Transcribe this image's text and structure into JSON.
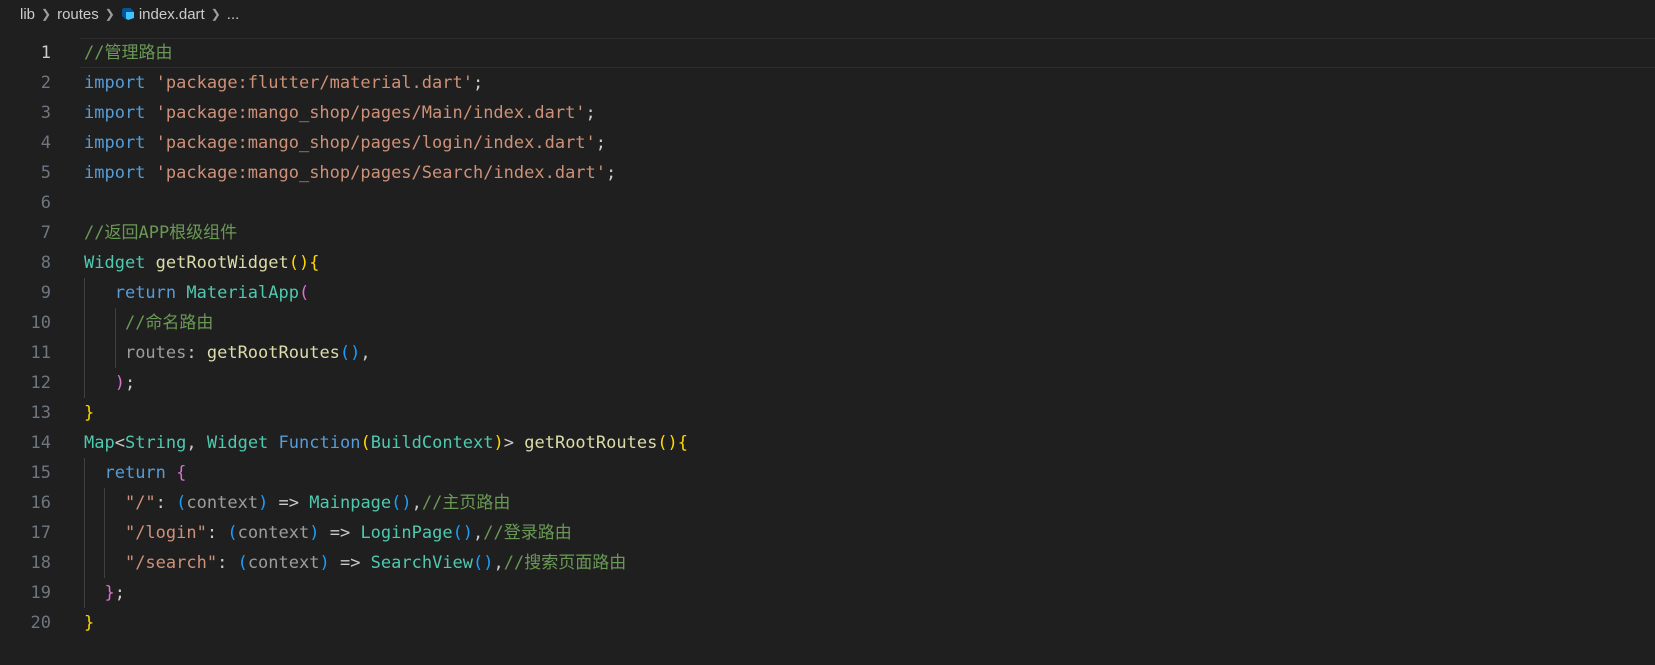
{
  "breadcrumb": {
    "items": [
      "lib",
      "routes",
      "index.dart",
      "..."
    ]
  },
  "editor": {
    "language": "dart",
    "active_line": 1,
    "line_numbers": [
      "1",
      "2",
      "3",
      "4",
      "5",
      "6",
      "7",
      "8",
      "9",
      "10",
      "11",
      "12",
      "13",
      "14",
      "15",
      "16",
      "17",
      "18",
      "19",
      "20"
    ],
    "lines": [
      [
        {
          "t": "//管理路由",
          "c": "comment"
        }
      ],
      [
        {
          "t": "import",
          "c": "keyword"
        },
        {
          "t": " ",
          "c": "plain"
        },
        {
          "t": "'package:flutter/material.dart'",
          "c": "string"
        },
        {
          "t": ";",
          "c": "plain"
        }
      ],
      [
        {
          "t": "import",
          "c": "keyword"
        },
        {
          "t": " ",
          "c": "plain"
        },
        {
          "t": "'package:mango_shop/pages/Main/index.dart'",
          "c": "string"
        },
        {
          "t": ";",
          "c": "plain"
        }
      ],
      [
        {
          "t": "import",
          "c": "keyword"
        },
        {
          "t": " ",
          "c": "plain"
        },
        {
          "t": "'package:mango_shop/pages/login/index.dart'",
          "c": "string"
        },
        {
          "t": ";",
          "c": "plain"
        }
      ],
      [
        {
          "t": "import",
          "c": "keyword"
        },
        {
          "t": " ",
          "c": "plain"
        },
        {
          "t": "'package:mango_shop/pages/Search/index.dart'",
          "c": "string"
        },
        {
          "t": ";",
          "c": "plain"
        }
      ],
      [],
      [
        {
          "t": "//返回APP根级组件",
          "c": "comment"
        }
      ],
      [
        {
          "t": "Widget",
          "c": "type"
        },
        {
          "t": " ",
          "c": "plain"
        },
        {
          "t": "getRootWidget",
          "c": "func"
        },
        {
          "t": "(){",
          "c": "brace1"
        }
      ],
      [
        {
          "t": "   ",
          "c": "plain"
        },
        {
          "t": "return",
          "c": "keyword"
        },
        {
          "t": " ",
          "c": "plain"
        },
        {
          "t": "MaterialApp",
          "c": "type"
        },
        {
          "t": "(",
          "c": "brace2"
        }
      ],
      [
        {
          "t": "    ",
          "c": "plain"
        },
        {
          "t": "//命名路由",
          "c": "comment"
        }
      ],
      [
        {
          "t": "    ",
          "c": "plain"
        },
        {
          "t": "routes",
          "c": "param"
        },
        {
          "t": ": ",
          "c": "plain"
        },
        {
          "t": "getRootRoutes",
          "c": "func"
        },
        {
          "t": "()",
          "c": "brace3"
        },
        {
          "t": ",",
          "c": "plain"
        }
      ],
      [
        {
          "t": "   ",
          "c": "plain"
        },
        {
          "t": ")",
          "c": "brace2"
        },
        {
          "t": ";",
          "c": "plain"
        }
      ],
      [
        {
          "t": "}",
          "c": "brace1"
        }
      ],
      [
        {
          "t": "Map",
          "c": "type"
        },
        {
          "t": "<",
          "c": "plain"
        },
        {
          "t": "String",
          "c": "type"
        },
        {
          "t": ", ",
          "c": "plain"
        },
        {
          "t": "Widget",
          "c": "type"
        },
        {
          "t": " ",
          "c": "plain"
        },
        {
          "t": "Function",
          "c": "keyword"
        },
        {
          "t": "(",
          "c": "brace1"
        },
        {
          "t": "BuildContext",
          "c": "type"
        },
        {
          "t": ")",
          "c": "brace1"
        },
        {
          "t": "> ",
          "c": "plain"
        },
        {
          "t": "getRootRoutes",
          "c": "func"
        },
        {
          "t": "(){",
          "c": "brace1"
        }
      ],
      [
        {
          "t": "  ",
          "c": "plain"
        },
        {
          "t": "return",
          "c": "keyword"
        },
        {
          "t": " ",
          "c": "plain"
        },
        {
          "t": "{",
          "c": "brace2"
        }
      ],
      [
        {
          "t": "    ",
          "c": "plain"
        },
        {
          "t": "\"/\"",
          "c": "string"
        },
        {
          "t": ": ",
          "c": "plain"
        },
        {
          "t": "(",
          "c": "brace3"
        },
        {
          "t": "context",
          "c": "param"
        },
        {
          "t": ")",
          "c": "brace3"
        },
        {
          "t": " => ",
          "c": "plain"
        },
        {
          "t": "Mainpage",
          "c": "type"
        },
        {
          "t": "()",
          "c": "brace3"
        },
        {
          "t": ",",
          "c": "plain"
        },
        {
          "t": "//主页路由",
          "c": "comment"
        }
      ],
      [
        {
          "t": "    ",
          "c": "plain"
        },
        {
          "t": "\"/login\"",
          "c": "string"
        },
        {
          "t": ": ",
          "c": "plain"
        },
        {
          "t": "(",
          "c": "brace3"
        },
        {
          "t": "context",
          "c": "param"
        },
        {
          "t": ")",
          "c": "brace3"
        },
        {
          "t": " => ",
          "c": "plain"
        },
        {
          "t": "LoginPage",
          "c": "type"
        },
        {
          "t": "()",
          "c": "brace3"
        },
        {
          "t": ",",
          "c": "plain"
        },
        {
          "t": "//登录路由",
          "c": "comment"
        }
      ],
      [
        {
          "t": "    ",
          "c": "plain"
        },
        {
          "t": "\"/search\"",
          "c": "string"
        },
        {
          "t": ": ",
          "c": "plain"
        },
        {
          "t": "(",
          "c": "brace3"
        },
        {
          "t": "context",
          "c": "param"
        },
        {
          "t": ")",
          "c": "brace3"
        },
        {
          "t": " => ",
          "c": "plain"
        },
        {
          "t": "SearchView",
          "c": "type"
        },
        {
          "t": "()",
          "c": "brace3"
        },
        {
          "t": ",",
          "c": "plain"
        },
        {
          "t": "//搜索页面路由",
          "c": "comment"
        }
      ],
      [
        {
          "t": "  ",
          "c": "plain"
        },
        {
          "t": "}",
          "c": "brace2"
        },
        {
          "t": ";",
          "c": "plain"
        }
      ],
      [
        {
          "t": "}",
          "c": "brace1"
        }
      ]
    ]
  },
  "colors": {
    "background": "#1f1f1f",
    "comment": "#6a9955",
    "keyword": "#569cd6",
    "string": "#ce9178",
    "type": "#4ec9b0",
    "func": "#dcdcaa",
    "brace_gold": "#ffd700",
    "brace_purple": "#da70d6",
    "brace_blue": "#179fff"
  }
}
